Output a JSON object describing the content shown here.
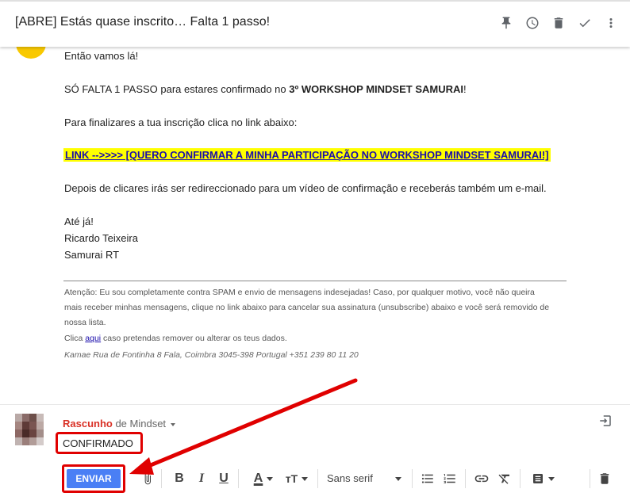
{
  "header": {
    "title": "[ABRE] Estás quase inscrito… Falta 1 passo!",
    "icons": [
      "pin-icon",
      "snooze-clock-icon",
      "delete-icon",
      "done-check-icon",
      "more-vert-icon"
    ]
  },
  "email": {
    "greeting": "Então vamos lá!",
    "line1_prefix": "SÓ FALTA 1 PASSO para estares confirmado no ",
    "line1_bold": "3º WORKSHOP MINDSET SAMURAI",
    "line1_suffix": "!",
    "line2": "Para finalizares a tua inscrição clica no link abaixo:",
    "link_text": "LINK -->>>> [QUERO CONFIRMAR A MINHA PARTICIPAÇÃO NO WORKSHOP MINDSET SAMURAI!]",
    "line3": "Depois de clicares irás ser redireccionado para um vídeo de confirmação e receberás também um e-mail.",
    "signoff": "Até já!",
    "signature_name": "Ricardo Teixeira",
    "signature_company": "Samurai RT",
    "footer_line1": "Atenção: Eu sou completamente contra SPAM e envio de mensagens indesejadas! Caso, por qualquer motivo, você não queira",
    "footer_line2": "mais receber minhas mensagens, clique no link abaixo para cancelar sua assinatura (unsubscribe) abaixo e você será removido de",
    "footer_line3": "nossa lista.",
    "footer_click_prefix": "Clica ",
    "footer_click_link": "aqui",
    "footer_click_suffix": " caso pretendas remover ou alterar os teus dados.",
    "footer_address": "Kamae Rua de Fontinha 8 Fala, Coimbra 3045-398 Portugal +351 239 80 11 20"
  },
  "compose": {
    "draft_label": "Rascunho",
    "from_text": " de Mindset",
    "body_text": "CONFIRMADO",
    "send_label": "ENVIAR",
    "font_name": "Sans serif"
  },
  "colors": {
    "send_button": "#4a7ff5",
    "highlight": "#ffff00",
    "annotation_red": "#e00000",
    "draft_red": "#d93025"
  }
}
